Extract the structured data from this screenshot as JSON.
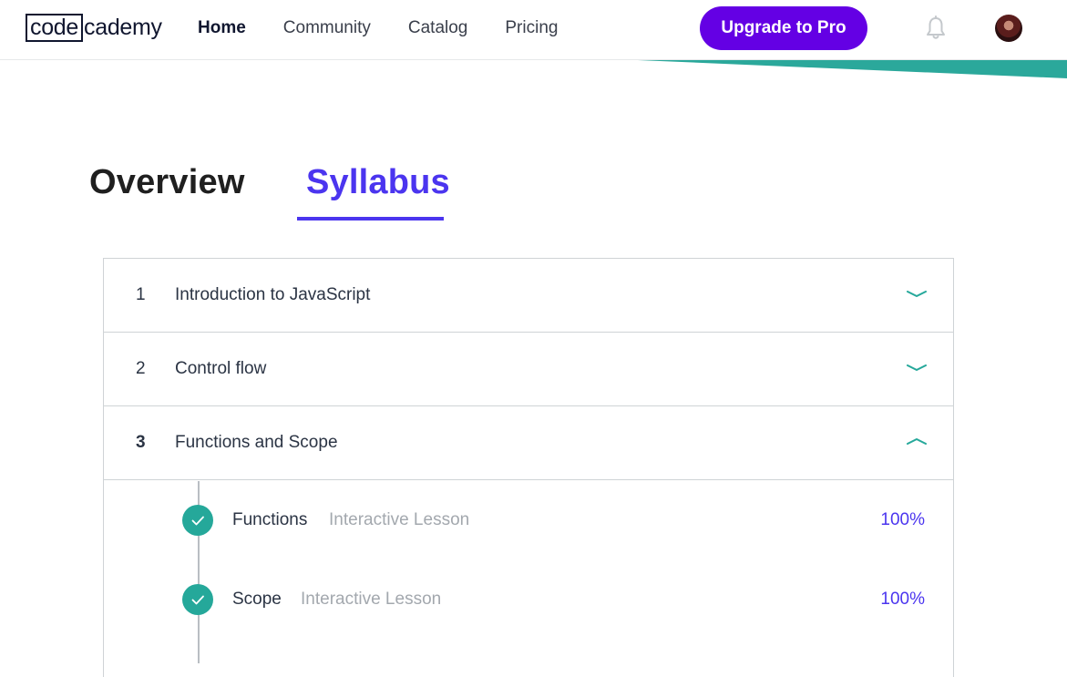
{
  "brand": {
    "logo_boxed": "code",
    "logo_rest": "cademy",
    "accent_purple": "#6400e4",
    "syllabus_blue": "#4b35ef",
    "teal": "#25a89a"
  },
  "nav": {
    "items": [
      {
        "label": "Home",
        "active": true
      },
      {
        "label": "Community",
        "active": false
      },
      {
        "label": "Catalog",
        "active": false
      },
      {
        "label": "Pricing",
        "active": false
      }
    ],
    "upgrade_label": "Upgrade to Pro",
    "icons": [
      "bell-icon",
      "avatar"
    ]
  },
  "tabs": {
    "overview": "Overview",
    "syllabus": "Syllabus",
    "active": "Syllabus"
  },
  "modules": [
    {
      "number": "1",
      "title": "Introduction to JavaScript",
      "expanded": false,
      "icon": "chevron-down-icon"
    },
    {
      "number": "2",
      "title": "Control flow",
      "expanded": false,
      "icon": "chevron-down-icon"
    },
    {
      "number": "3",
      "title": "Functions and Scope",
      "expanded": true,
      "icon": "chevron-up-icon"
    }
  ],
  "lessons": [
    {
      "title": "Functions",
      "type": "Interactive Lesson",
      "progress": "100%",
      "completed": true,
      "icon": "check-icon"
    },
    {
      "title": "Scope",
      "type": "Interactive Lesson",
      "progress": "100%",
      "completed": true,
      "icon": "check-icon"
    }
  ]
}
